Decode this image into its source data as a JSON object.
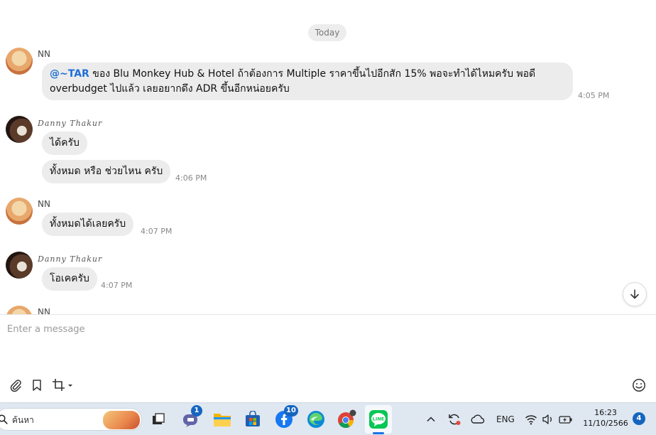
{
  "chat": {
    "date_label": "Today",
    "messages": [
      {
        "sender": "NN",
        "text_mention": "@~TAR",
        "text_line1": " ของ Blu Monkey Hub & Hotel ถ้าต้องการ Multiple ราคาขึ้นไปอีกสัก 15% พอจะทำได้ไหมครับ พอดี",
        "text_line2": "overbudget ไปแล้ว เลยอยากดึง ADR ขึ้นอีกหน่อยครับ",
        "time": "4:05 PM"
      },
      {
        "sender": "Danny Thakur",
        "text": "ได้ครับ"
      },
      {
        "text": "ทั้งหมด หรือ ช่วยไหน ครับ",
        "time": "4:06 PM"
      },
      {
        "sender": "NN",
        "text": "ทั้งหมดได้เลยครับ",
        "time": "4:07 PM"
      },
      {
        "sender": "Danny Thakur",
        "text": "โอเคครับ",
        "time": "4:07 PM"
      },
      {
        "sender": "NN"
      }
    ]
  },
  "composer": {
    "placeholder": "Enter a message"
  },
  "taskbar": {
    "search_text": "ค้นหา",
    "teams_badge": "1",
    "facebook_badge": "10",
    "lang": "ENG",
    "time": "16:23",
    "date": "11/10/2566",
    "notifications": "4"
  },
  "colors": {
    "mention": "#1f6fd6",
    "bubble": "#ececec",
    "line_green": "#06c755",
    "taskbar": "#dfe7f1"
  }
}
